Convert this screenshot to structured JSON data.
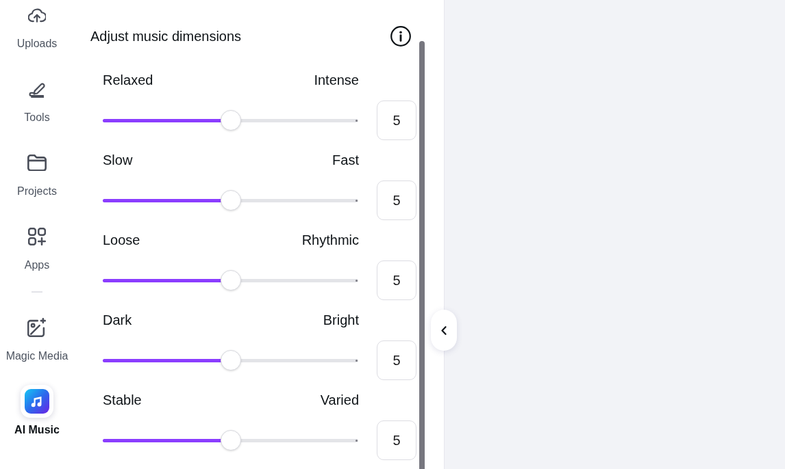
{
  "sidebar": {
    "sections": [
      {
        "items": [
          {
            "label": "Uploads",
            "selected": false
          },
          {
            "label": "Tools",
            "selected": false
          },
          {
            "label": "Projects",
            "selected": false
          },
          {
            "label": "Apps",
            "selected": false
          }
        ]
      },
      {
        "items": [
          {
            "label": "Magic Media",
            "selected": false
          },
          {
            "label": "AI Music",
            "selected": true
          }
        ]
      }
    ]
  },
  "panel": {
    "title": "Adjust music dimensions",
    "sliders": [
      {
        "left_label": "Relaxed",
        "right_label": "Intense",
        "level": 0.5,
        "value": "5"
      },
      {
        "left_label": "Slow",
        "right_label": "Fast",
        "level": 0.5,
        "value": "5"
      },
      {
        "left_label": "Loose",
        "right_label": "Rhythmic",
        "level": 0.5,
        "value": "5"
      },
      {
        "left_label": "Dark",
        "right_label": "Bright",
        "level": 0.5,
        "value": "5"
      },
      {
        "left_label": "Stable",
        "right_label": "Varied",
        "level": 0.5,
        "value": "5"
      }
    ]
  }
}
